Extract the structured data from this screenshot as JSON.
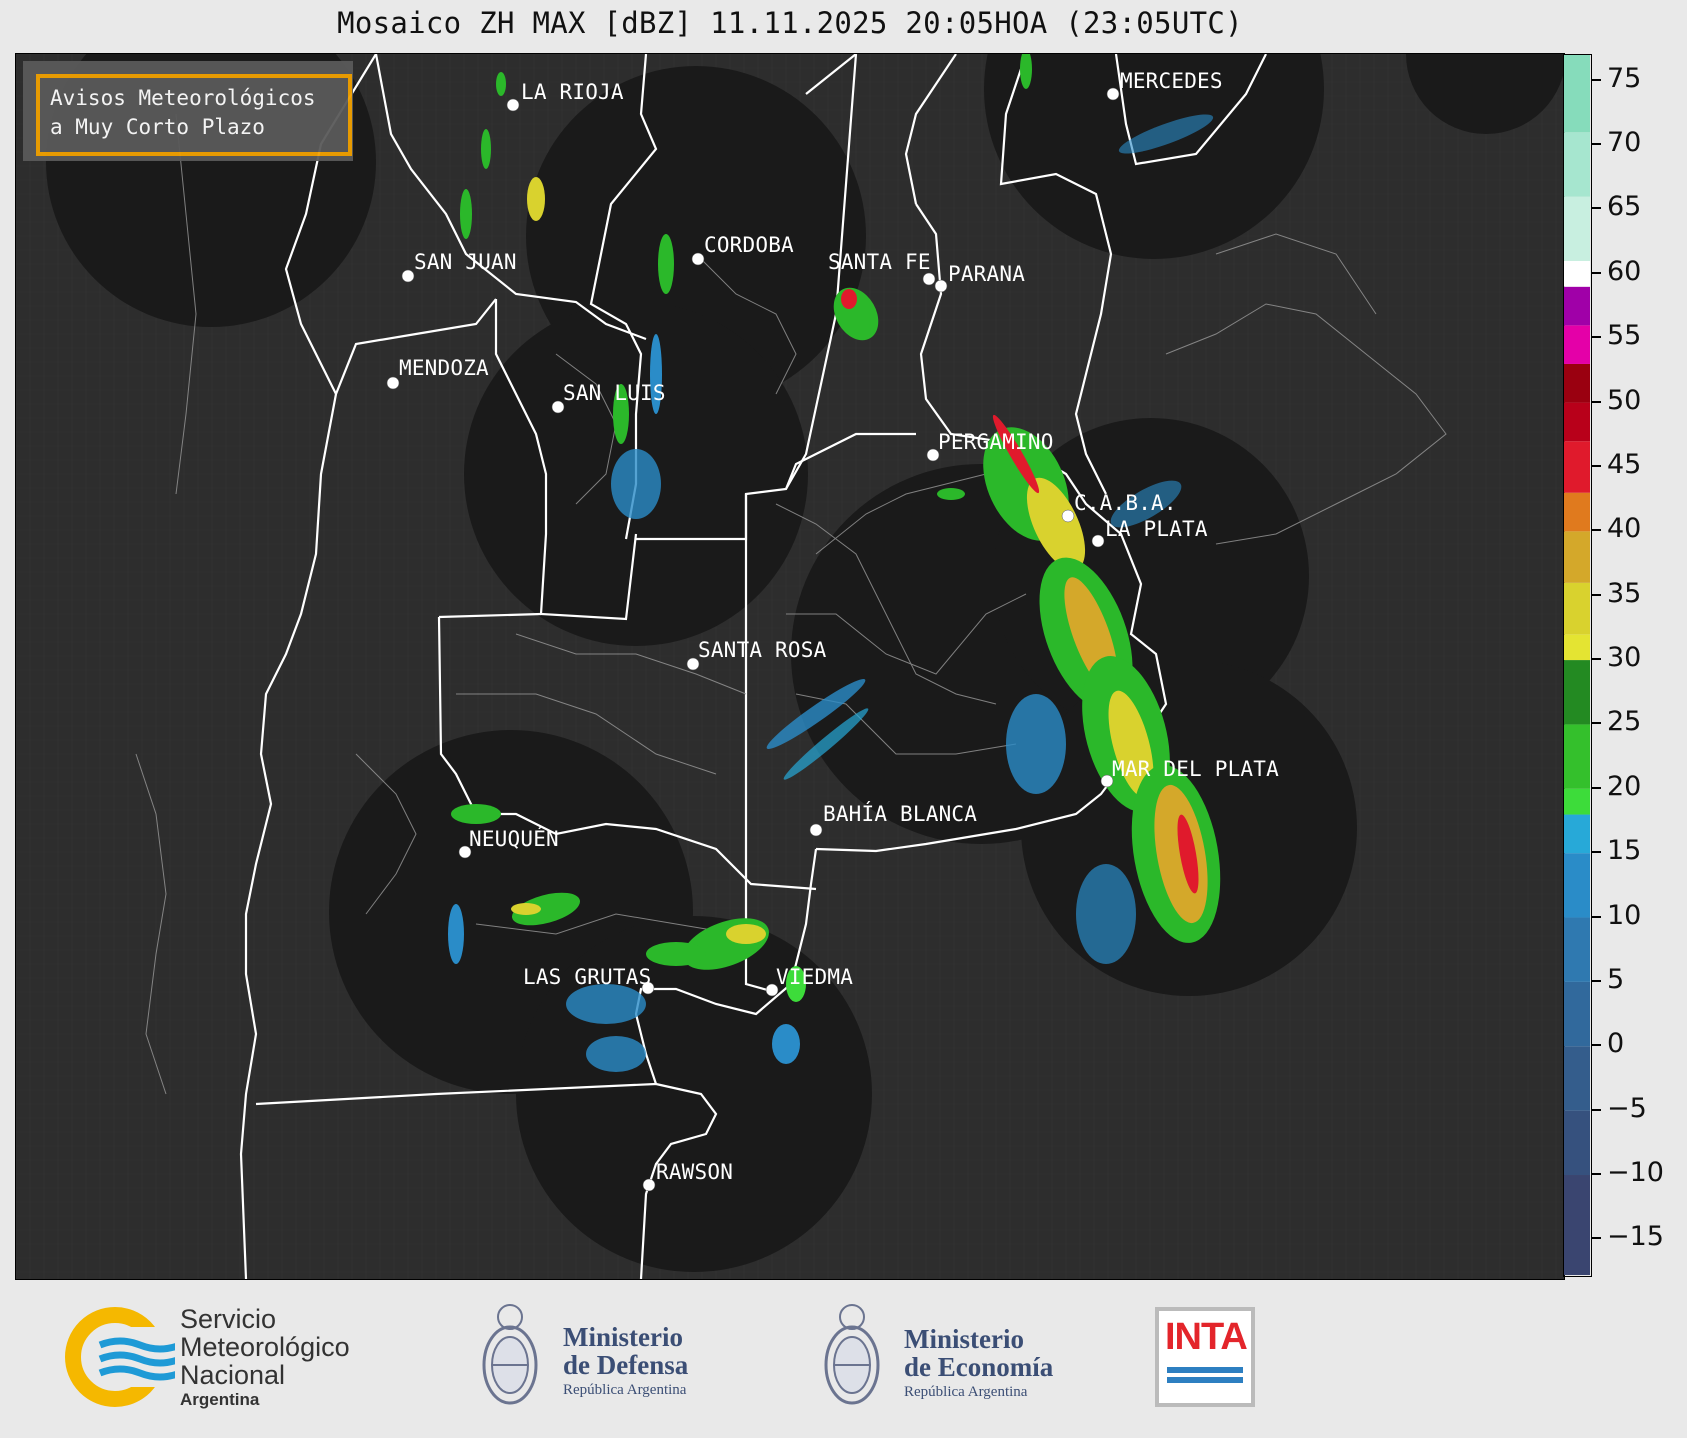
{
  "title": "Mosaico ZH MAX [dBZ] 11.11.2025 20:05HOA (23:05UTC)",
  "avisos": {
    "line1": "Avisos Meteorológicos",
    "line2": "a Muy Corto Plazo"
  },
  "cities": [
    {
      "name": "LA RIOJA"
    },
    {
      "name": "MERCEDES"
    },
    {
      "name": "CORDOBA"
    },
    {
      "name": "SAN JUAN"
    },
    {
      "name": "SANTA FE"
    },
    {
      "name": "PARANA"
    },
    {
      "name": "MENDOZA"
    },
    {
      "name": "SAN LUIS"
    },
    {
      "name": "PERGAMINO"
    },
    {
      "name": "C.A.B.A."
    },
    {
      "name": "LA PLATA"
    },
    {
      "name": "SANTA ROSA"
    },
    {
      "name": "MAR DEL PLATA"
    },
    {
      "name": "BAHÍA BLANCA"
    },
    {
      "name": "NEUQUÉN"
    },
    {
      "name": "LAS GRUTAS"
    },
    {
      "name": "VIEDMA"
    },
    {
      "name": "RAWSON"
    }
  ],
  "colorbar": {
    "min": -18,
    "max": 77,
    "ticks": [
      "75",
      "70",
      "65",
      "60",
      "55",
      "50",
      "45",
      "40",
      "35",
      "30",
      "25",
      "20",
      "15",
      "10",
      "5",
      "0",
      "−5",
      "−10",
      "−15"
    ],
    "tick_values": [
      75,
      70,
      65,
      60,
      55,
      50,
      45,
      40,
      35,
      30,
      25,
      20,
      15,
      10,
      5,
      0,
      -5,
      -10,
      -15
    ],
    "stops": [
      {
        "from": -18,
        "to": -10,
        "color": "#3a4570"
      },
      {
        "from": -10,
        "to": -5,
        "color": "#36517e"
      },
      {
        "from": -5,
        "to": 0,
        "color": "#345d8c"
      },
      {
        "from": 0,
        "to": 5,
        "color": "#31699c"
      },
      {
        "from": 5,
        "to": 10,
        "color": "#2f79b0"
      },
      {
        "from": 10,
        "to": 15,
        "color": "#2a8cc8"
      },
      {
        "from": 15,
        "to": 18,
        "color": "#27a9d8"
      },
      {
        "from": 18,
        "to": 20,
        "color": "#3ddc3a"
      },
      {
        "from": 20,
        "to": 25,
        "color": "#34c02c"
      },
      {
        "from": 25,
        "to": 30,
        "color": "#238a22"
      },
      {
        "from": 30,
        "to": 32,
        "color": "#e4e432"
      },
      {
        "from": 32,
        "to": 36,
        "color": "#d9d22e"
      },
      {
        "from": 36,
        "to": 40,
        "color": "#d4a82a"
      },
      {
        "from": 40,
        "to": 43,
        "color": "#e07a1e"
      },
      {
        "from": 43,
        "to": 47,
        "color": "#e01a2c"
      },
      {
        "from": 47,
        "to": 50,
        "color": "#b8001a"
      },
      {
        "from": 50,
        "to": 53,
        "color": "#9a0010"
      },
      {
        "from": 53,
        "to": 56,
        "color": "#e400a8"
      },
      {
        "from": 56,
        "to": 59,
        "color": "#a000a8"
      },
      {
        "from": 59,
        "to": 61,
        "color": "#ffffff"
      },
      {
        "from": 61,
        "to": 66,
        "color": "#c8efe0"
      },
      {
        "from": 66,
        "to": 71,
        "color": "#a6e6cf"
      },
      {
        "from": 71,
        "to": 77,
        "color": "#86dcbb"
      }
    ]
  },
  "logos": {
    "smn": {
      "line1": "Servicio",
      "line2": "Meteorológico",
      "line3": "Nacional",
      "line4": "Argentina"
    },
    "defensa": {
      "line1": "Ministerio",
      "line2": "de Defensa",
      "line3": "República Argentina"
    },
    "economia": {
      "line1": "Ministerio",
      "line2": "de Economía",
      "line3": "República Argentina"
    },
    "inta": {
      "text": "INTA"
    }
  },
  "colors": {
    "radar_coverage": "#1a1a1a",
    "map_background": "#2d2d2d",
    "borders": "#ffffff",
    "avisos_border": "#f2a100"
  }
}
